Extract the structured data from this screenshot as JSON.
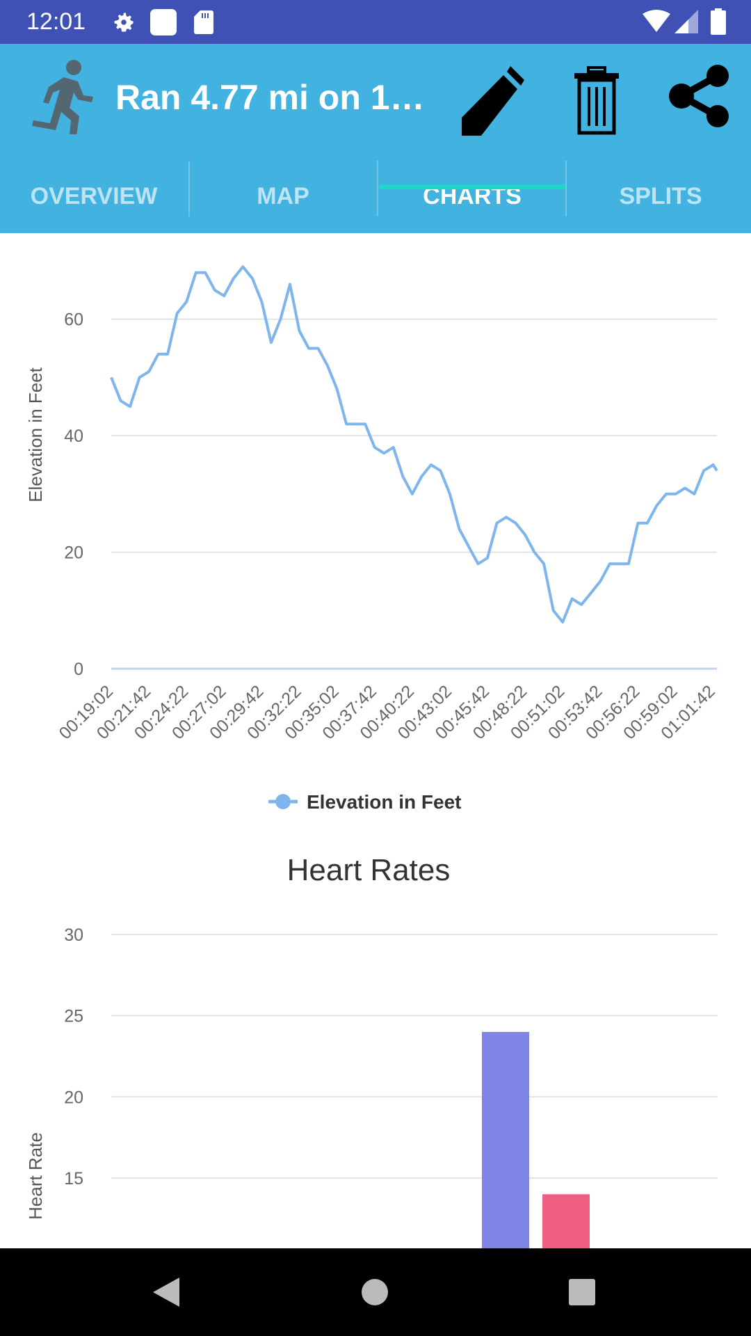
{
  "status_bar": {
    "time": "12:01",
    "icons": [
      "gear-icon",
      "sim-card-icon",
      "sd-card-icon",
      "wifi-icon",
      "cell-signal-icon",
      "battery-icon"
    ],
    "color": "#3F51B5"
  },
  "app_bar": {
    "title": "Ran 4.77 mi on 1…",
    "app_icon": "running-man-icon",
    "actions": [
      "edit-pencil-icon",
      "delete-trash-icon",
      "share-icon"
    ],
    "color": "#42B2E0"
  },
  "tabs": [
    {
      "label": "OVERVIEW",
      "active": false
    },
    {
      "label": "MAP",
      "active": false
    },
    {
      "label": "CHARTS",
      "active": true
    },
    {
      "label": "SPLITS",
      "active": false
    }
  ],
  "tab_indicator_color": "#1ED6C8",
  "chart_data": [
    {
      "type": "line",
      "title": "",
      "xlabel": "",
      "ylabel": "Elevation in Feet",
      "ylim": [
        0,
        70
      ],
      "yticks": [
        0,
        20,
        40,
        60
      ],
      "xticks": [
        "00:19:02",
        "00:21:42",
        "00:24:22",
        "00:27:02",
        "00:29:42",
        "00:32:22",
        "00:35:02",
        "00:37:42",
        "00:40:22",
        "00:43:02",
        "00:45:42",
        "00:48:22",
        "00:51:02",
        "00:53:42",
        "00:56:22",
        "00:59:02",
        "01:01:42"
      ],
      "xlim": [
        "00:19:02",
        "01:01:58"
      ],
      "grid": true,
      "legend": "bottom",
      "series": [
        {
          "name": "Elevation in Feet",
          "color": "#7EB5EC",
          "x": [
            "00:19:02",
            "00:19:42",
            "00:20:22",
            "00:21:02",
            "00:21:42",
            "00:22:22",
            "00:23:02",
            "00:23:42",
            "00:24:22",
            "00:25:02",
            "00:25:42",
            "00:26:22",
            "00:27:02",
            "00:27:42",
            "00:28:22",
            "00:29:02",
            "00:29:42",
            "00:30:22",
            "00:31:02",
            "00:31:42",
            "00:32:22",
            "00:33:02",
            "00:33:42",
            "00:34:22",
            "00:35:02",
            "00:35:42",
            "00:36:22",
            "00:37:02",
            "00:37:42",
            "00:38:22",
            "00:39:02",
            "00:39:42",
            "00:40:22",
            "00:41:02",
            "00:41:42",
            "00:42:22",
            "00:43:02",
            "00:43:42",
            "00:44:22",
            "00:45:02",
            "00:45:42",
            "00:46:22",
            "00:47:02",
            "00:47:42",
            "00:48:22",
            "00:49:02",
            "00:49:42",
            "00:50:22",
            "00:51:02",
            "00:51:42",
            "00:52:22",
            "00:53:02",
            "00:53:42",
            "00:54:22",
            "00:55:02",
            "00:55:42",
            "00:56:22",
            "00:57:02",
            "00:57:42",
            "00:58:22",
            "00:59:02",
            "00:59:42",
            "01:00:22",
            "01:01:02",
            "01:01:42",
            "01:01:58"
          ],
          "y": [
            50,
            46,
            45,
            50,
            51,
            54,
            54,
            61,
            63,
            68,
            68,
            65,
            64,
            67,
            69,
            67,
            63,
            56,
            60,
            66,
            58,
            55,
            55,
            52,
            48,
            42,
            42,
            42,
            38,
            37,
            38,
            33,
            30,
            33,
            35,
            34,
            30,
            24,
            21,
            18,
            19,
            25,
            26,
            25,
            23,
            20,
            18,
            10,
            8,
            12,
            11,
            13,
            15,
            18,
            18,
            18,
            25,
            25,
            28,
            30,
            30,
            31,
            30,
            34,
            35,
            34
          ]
        }
      ]
    },
    {
      "type": "bar",
      "title": "Heart Rates",
      "xlabel": "",
      "ylabel": "Heart Rate",
      "yticks": [
        15,
        20,
        25,
        30
      ],
      "ylim": [
        10,
        30
      ],
      "grid": true,
      "values": [
        24,
        14
      ],
      "colors": [
        "#8186E6",
        "#F05F82"
      ]
    }
  ]
}
